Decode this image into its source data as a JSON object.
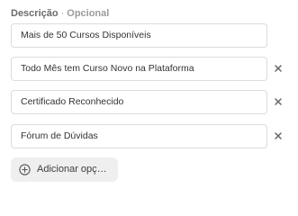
{
  "section": {
    "title": "Descrição",
    "separator": "·",
    "optional_label": "Opcional"
  },
  "options": [
    {
      "value": "Mais de 50 Cursos Disponíveis",
      "removable": false
    },
    {
      "value": "Todo Mês tem Curso Novo na Plataforma",
      "removable": true
    },
    {
      "value": "Certificado Reconhecido",
      "removable": true
    },
    {
      "value": "Fórum de Dúvidas",
      "removable": true
    }
  ],
  "icons": {
    "remove": "close-icon",
    "add": "plus-circle-icon"
  },
  "add_button": {
    "label": "Adicionar opç…"
  },
  "colors": {
    "border": "#dcdcdc",
    "button_bg": "#efefef",
    "icon": "#666666"
  }
}
